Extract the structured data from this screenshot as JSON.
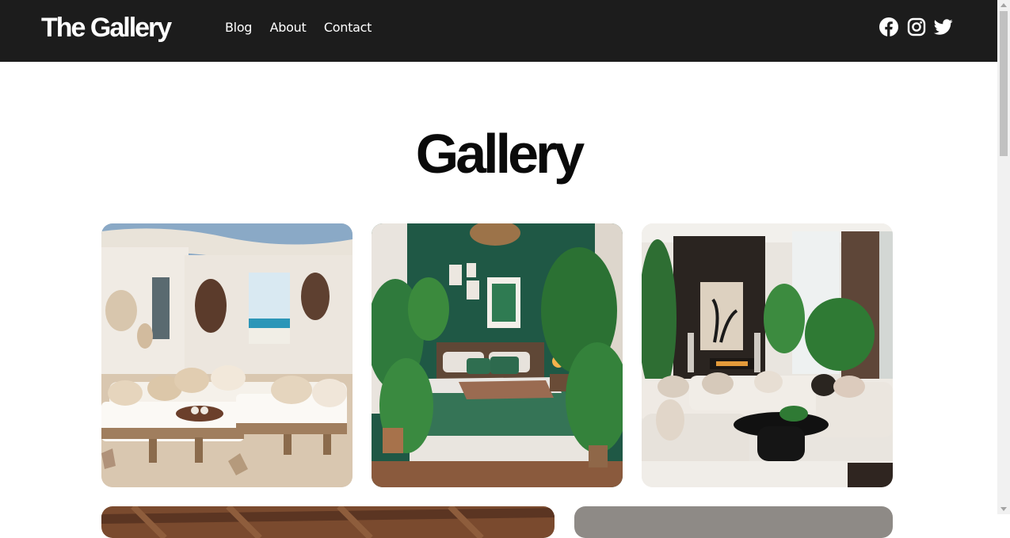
{
  "site": {
    "brand": "The Gallery",
    "nav": [
      {
        "label": "Blog"
      },
      {
        "label": "About"
      },
      {
        "label": "Contact"
      }
    ],
    "social": [
      "facebook-icon",
      "instagram-icon",
      "twitter-icon"
    ]
  },
  "page": {
    "title": "Gallery"
  },
  "gallery": {
    "images": [
      {
        "name": "beach-lounge-image"
      },
      {
        "name": "green-bedroom-image"
      },
      {
        "name": "modern-living-room-image"
      },
      {
        "name": "wood-interior-image"
      },
      {
        "name": "gray-interior-image"
      }
    ]
  },
  "colors": {
    "navbar": "#1c1c1c",
    "text": "#0a0a0a",
    "background": "#ffffff"
  }
}
